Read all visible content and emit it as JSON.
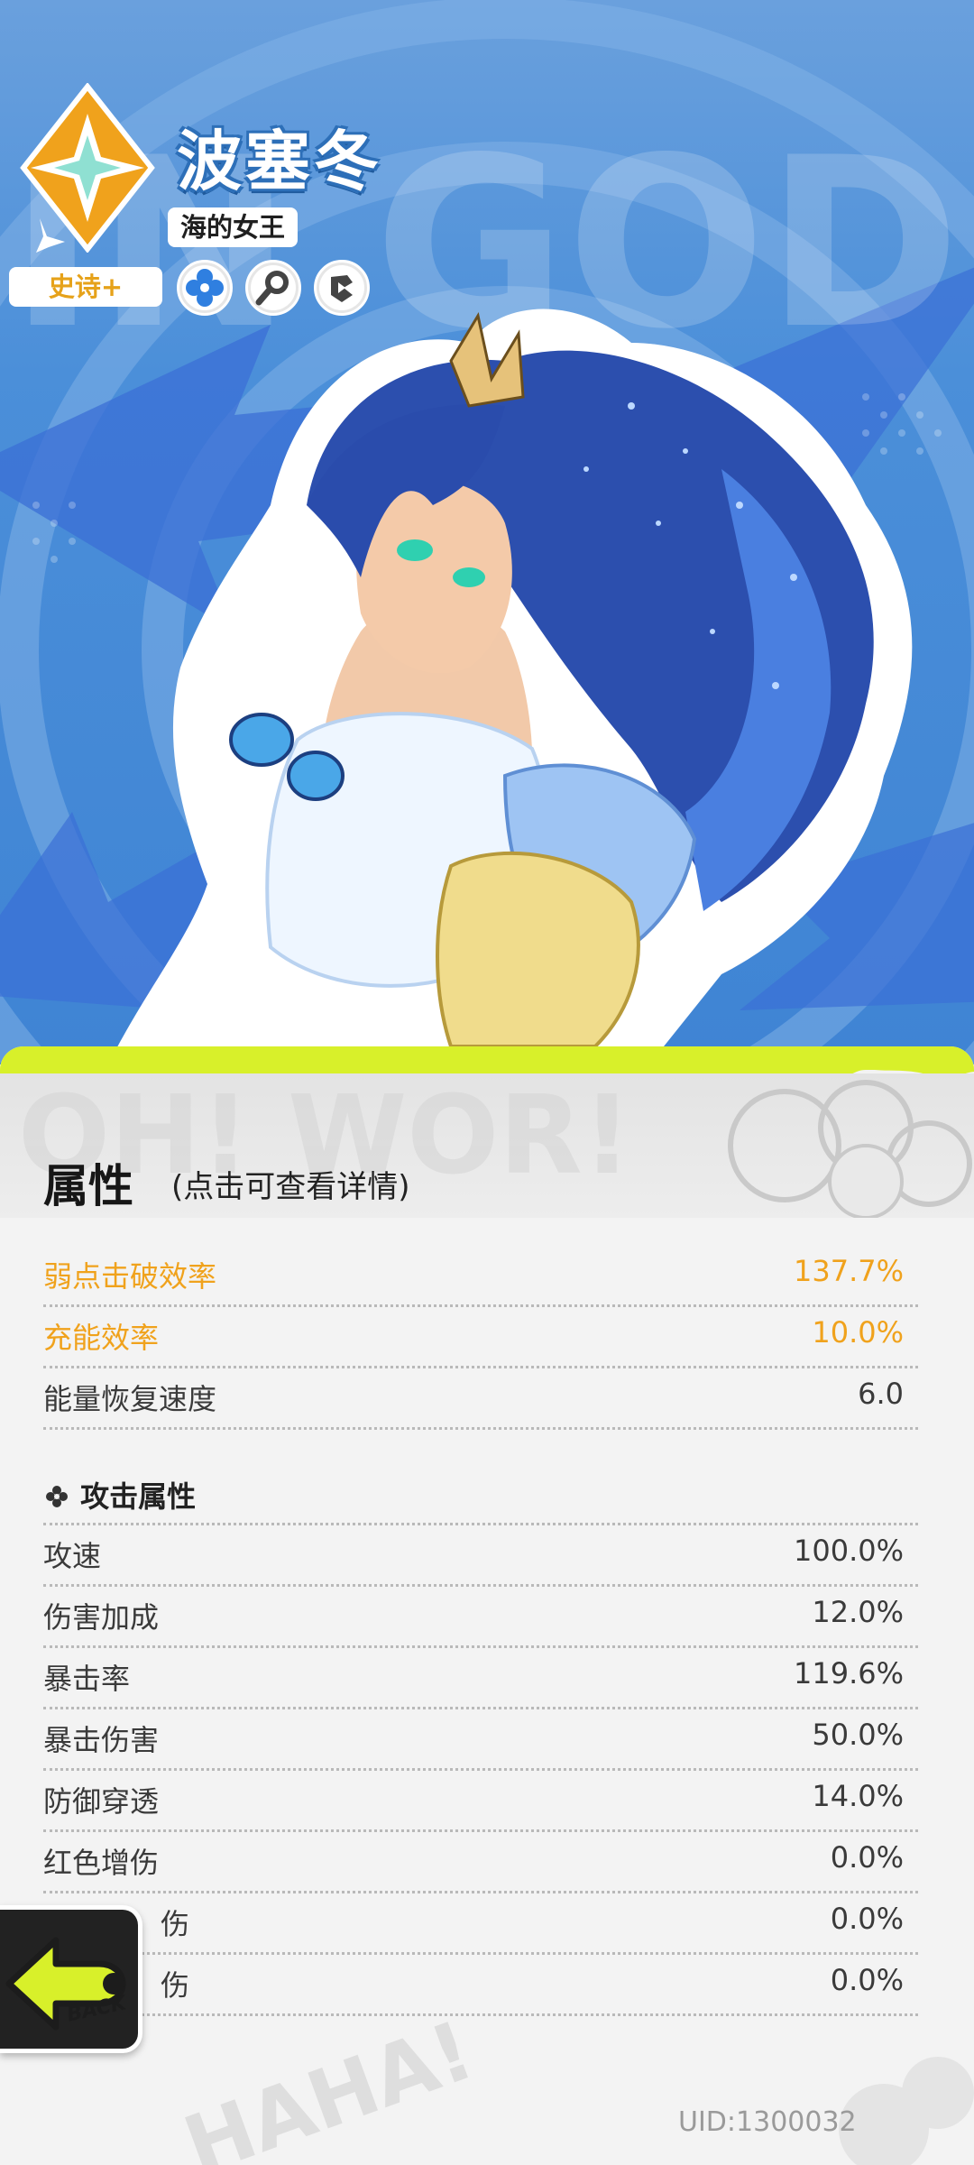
{
  "hero": {
    "name": "波塞冬",
    "title": "海的女王",
    "rarity": "史诗+",
    "background_text": "IN GOD",
    "tags": [
      "flower-tag-icon",
      "key-tag-icon",
      "shield-tag-icon"
    ]
  },
  "attributes": {
    "section_title": "属性",
    "hint": "(点击可查看详情)",
    "base": [
      {
        "name": "弱点击破效率",
        "value": "137.7%",
        "highlight": true
      },
      {
        "name": "充能效率",
        "value": "10.0%",
        "highlight": true
      },
      {
        "name": "能量恢复速度",
        "value": "6.0",
        "highlight": false
      }
    ],
    "attack_group": {
      "title": "攻击属性",
      "rows": [
        {
          "name": "攻速",
          "value": "100.0%"
        },
        {
          "name": "伤害加成",
          "value": "12.0%"
        },
        {
          "name": "暴击率",
          "value": "119.6%"
        },
        {
          "name": "暴击伤害",
          "value": "50.0%"
        },
        {
          "name": "防御穿透",
          "value": "14.0%"
        },
        {
          "name": "红色增伤",
          "value": "0.0%"
        },
        {
          "name": "伤",
          "value": "0.0%"
        },
        {
          "name": "伤",
          "value": "0.0%"
        }
      ]
    }
  },
  "footer": {
    "uid": "UID:1300032"
  },
  "back_button": {
    "label": "BACK"
  },
  "colors": {
    "accent_orange": "#f0a21c",
    "hero_blue": "#4b8fd9",
    "slime_green": "#d8f02a"
  }
}
